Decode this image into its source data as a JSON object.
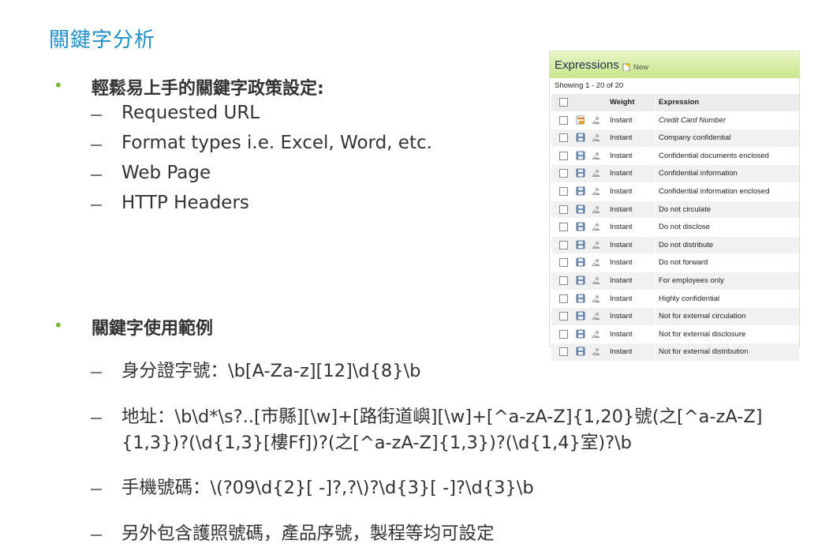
{
  "slide": {
    "title": "關鍵字分析",
    "bullet_marker": "•",
    "dash_marker": "–",
    "bullet1": {
      "text": "輕鬆易上手的關鍵字政策設定:",
      "items": [
        "Requested URL",
        "Format types i.e. Excel, Word, etc.",
        "Web Page",
        "HTTP Headers"
      ]
    },
    "bullet2": {
      "text": "關鍵字使用範例",
      "items": [
        "身分證字號：\\b[A-Za-z][12]\\d{8}\\b",
        "地址：\\b\\d*\\s?..[市縣][\\w]+[路街道嶼][\\w]+[^a-zA-Z]{1,20}號(之[^a-zA-Z]{1,3})?(\\d{1,3}[樓Ff])?(之[^a-zA-Z]{1,3})?(\\d{1,4}室)?\\b",
        "手機號碼：\\(?09\\d{2}[ -]?,?\\)?\\d{3}[ -]?\\d{3}\\b",
        "另外包含護照號碼，產品序號，製程等均可設定"
      ]
    }
  },
  "panel": {
    "title": "Expressions",
    "new_label": "New",
    "showing": "Showing 1 - 20 of 20",
    "columns": {
      "weight": "Weight",
      "expression": "Expression"
    },
    "rows": [
      {
        "weight": "Instant",
        "expression": "Credit Card Number",
        "icon": "credit-card-icon"
      },
      {
        "weight": "Instant",
        "expression": "Company confidential",
        "icon": "save-icon"
      },
      {
        "weight": "Instant",
        "expression": "Confidential documents enclosed",
        "icon": "save-icon"
      },
      {
        "weight": "Instant",
        "expression": "Confidential information",
        "icon": "save-icon"
      },
      {
        "weight": "Instant",
        "expression": "Confidential information enclosed",
        "icon": "save-icon"
      },
      {
        "weight": "Instant",
        "expression": "Do not circulate",
        "icon": "save-icon"
      },
      {
        "weight": "Instant",
        "expression": "Do not disclose",
        "icon": "save-icon"
      },
      {
        "weight": "Instant",
        "expression": "Do not distribute",
        "icon": "save-icon"
      },
      {
        "weight": "Instant",
        "expression": "Do not forward",
        "icon": "save-icon"
      },
      {
        "weight": "Instant",
        "expression": "For employees only",
        "icon": "save-icon"
      },
      {
        "weight": "Instant",
        "expression": "Highly confidential",
        "icon": "save-icon"
      },
      {
        "weight": "Instant",
        "expression": "Not for external circulation",
        "icon": "save-icon"
      },
      {
        "weight": "Instant",
        "expression": "Not for external disclosure",
        "icon": "save-icon"
      },
      {
        "weight": "Instant",
        "expression": "Not for external distribution",
        "icon": "save-icon"
      }
    ],
    "colors": {
      "header_top": "#e8f5c6",
      "header_bottom": "#c9e58a",
      "title": "#1e2f52"
    }
  },
  "colors": {
    "title": "#1f8fc9",
    "bullet": "#7ab833",
    "text": "#333333"
  }
}
